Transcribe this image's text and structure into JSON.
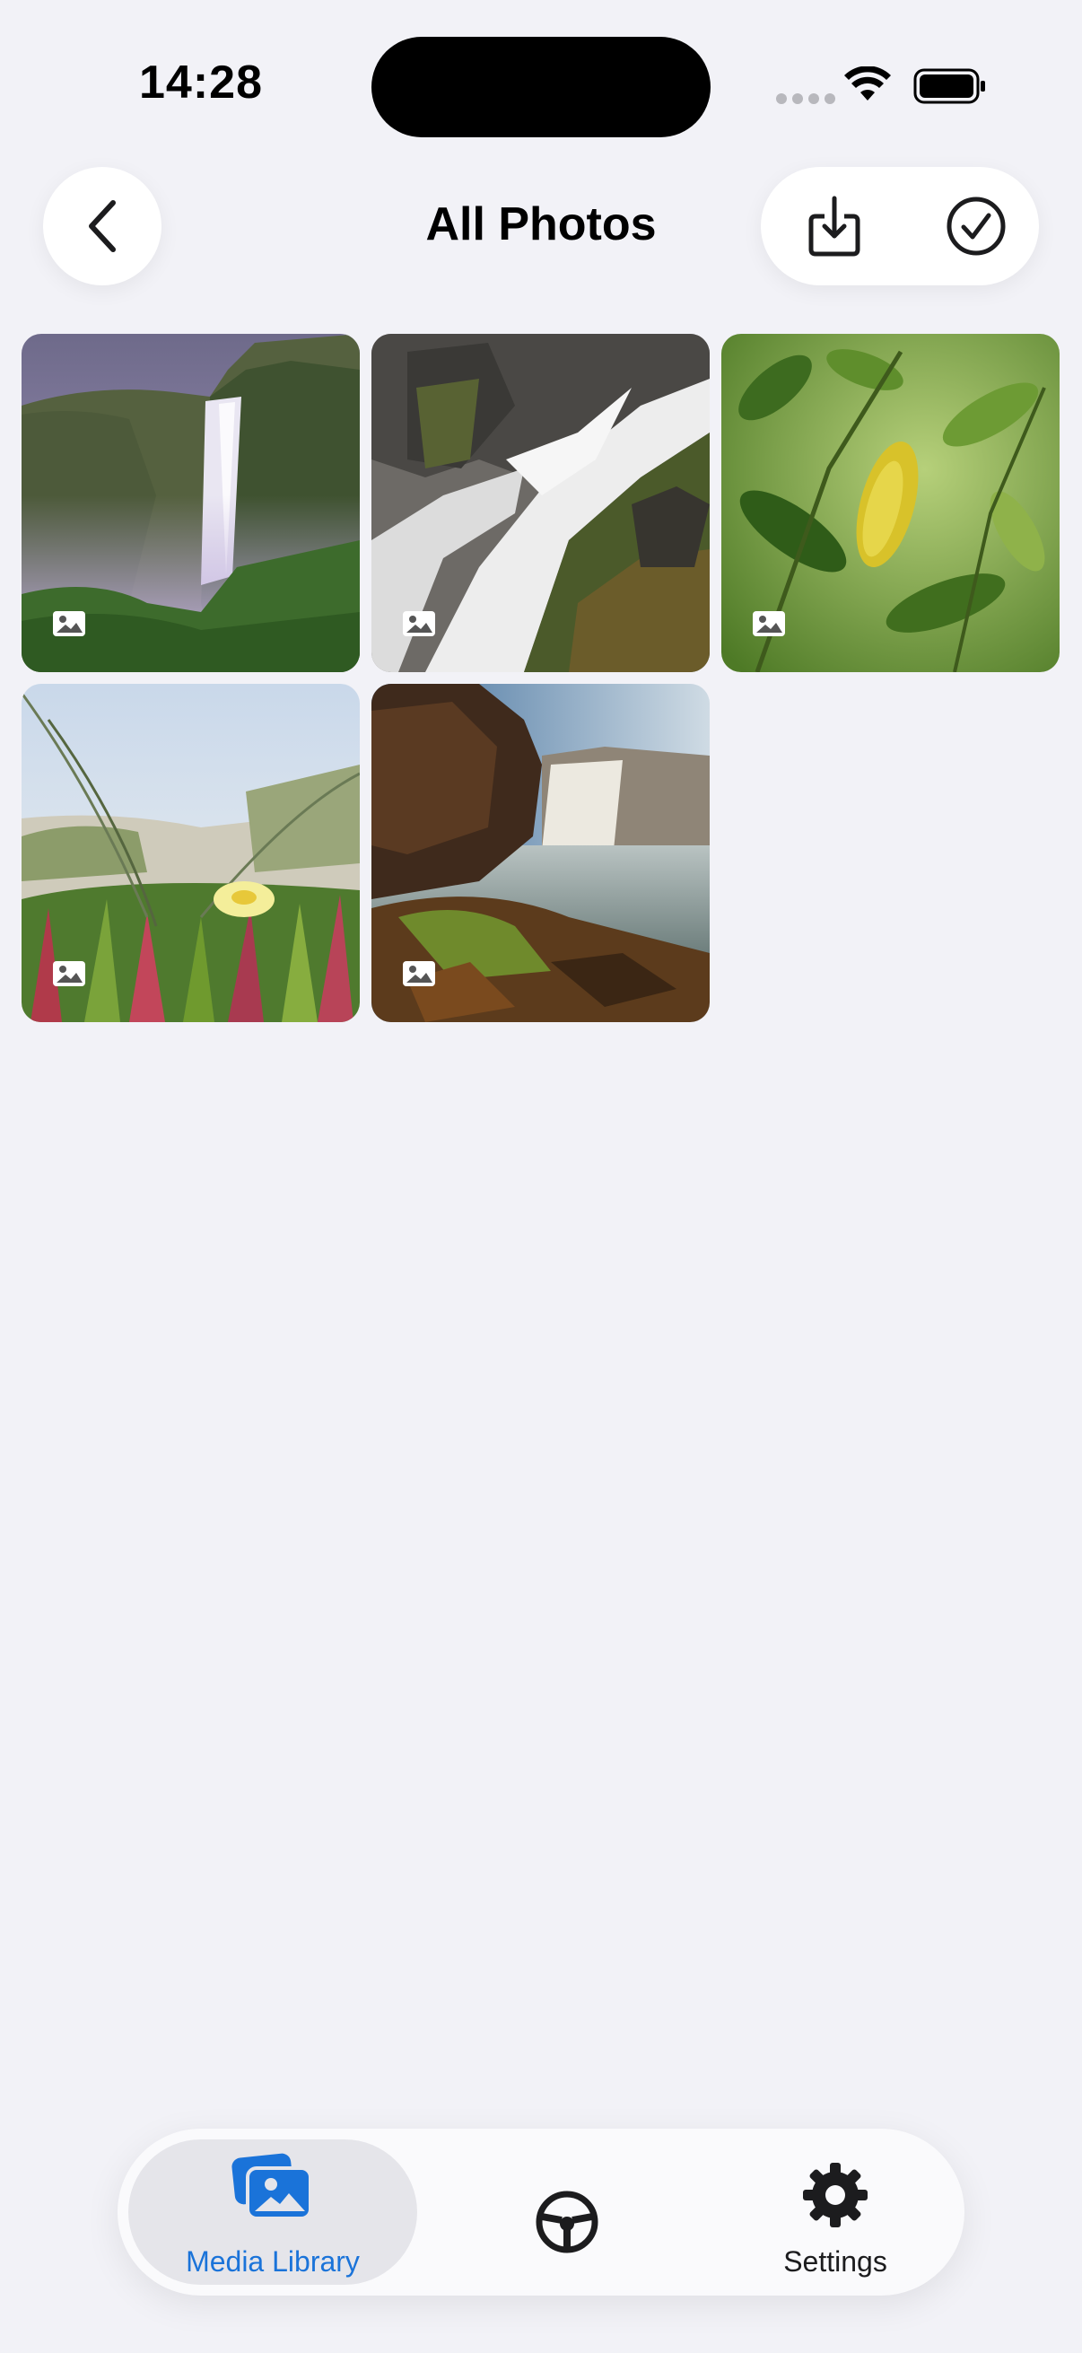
{
  "status_bar": {
    "time": "14:28"
  },
  "header": {
    "title": "All Photos"
  },
  "photos": [
    {
      "kind": "image",
      "subject": "waterfall-mist"
    },
    {
      "kind": "image",
      "subject": "waterfall-rocks"
    },
    {
      "kind": "image",
      "subject": "green-leaves"
    },
    {
      "kind": "image",
      "subject": "flower-grass"
    },
    {
      "kind": "image",
      "subject": "waterfall-cliff"
    }
  ],
  "tabbar": {
    "media_label": "Media Library",
    "settings_label": "Settings",
    "active_color": "#1a73d9"
  }
}
